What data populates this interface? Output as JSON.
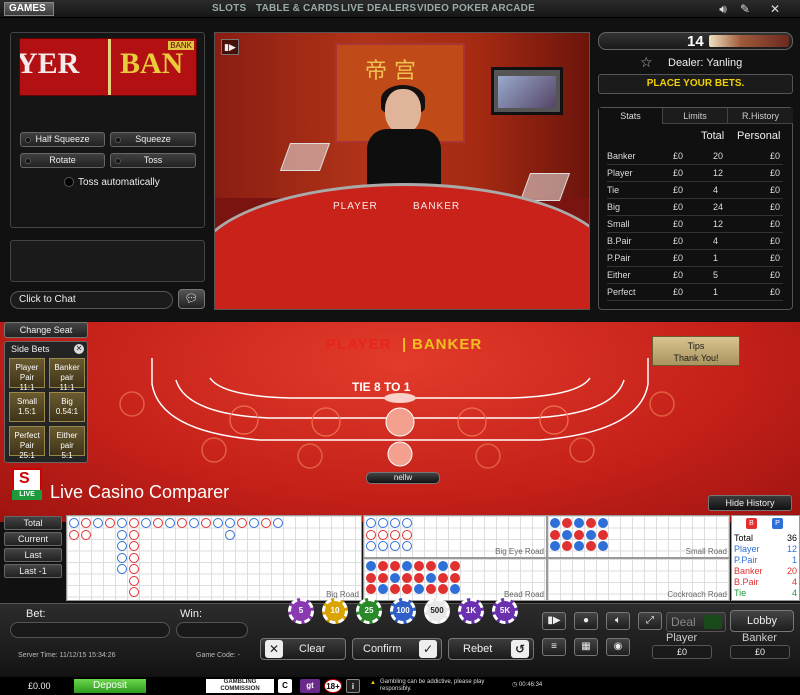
{
  "nav": {
    "games": "GAMES",
    "links": [
      "SLOTS",
      "TABLE & CARDS",
      "LIVE DEALERS",
      "VIDEO POKER",
      "ARCADE"
    ]
  },
  "left_panel": {
    "mini_cam": {
      "player_text": "YER",
      "banker_text": "BAN",
      "tag": "BANK"
    },
    "half_squeeze": "Half Squeeze",
    "squeeze": "Squeeze",
    "rotate": "Rotate",
    "toss": "Toss",
    "toss_auto": "Toss automatically",
    "chat_placeholder": "Click to Chat"
  },
  "video": {
    "chinese_chars": "帝 宫",
    "player_label": "PLAYER",
    "banker_label": "BANKER"
  },
  "right_panel": {
    "shoe_count": "14",
    "shoe_fraction": 0.4,
    "dealer": "Dealer: Yanling",
    "status": "PLACE YOUR BETS.",
    "tabs": [
      "Stats",
      "Limits",
      "R.History"
    ],
    "headers": {
      "total": "Total",
      "personal": "Personal"
    },
    "rows": [
      {
        "name": "Banker",
        "amount": "£0",
        "total": "20",
        "personal": "£0"
      },
      {
        "name": "Player",
        "amount": "£0",
        "total": "12",
        "personal": "£0"
      },
      {
        "name": "Tie",
        "amount": "£0",
        "total": "4",
        "personal": "£0"
      },
      {
        "name": "Big",
        "amount": "£0",
        "total": "24",
        "personal": "£0"
      },
      {
        "name": "Small",
        "amount": "£0",
        "total": "12",
        "personal": "£0"
      },
      {
        "name": "B.Pair",
        "amount": "£0",
        "total": "4",
        "personal": "£0"
      },
      {
        "name": "P.Pair",
        "amount": "£0",
        "total": "1",
        "personal": "£0"
      },
      {
        "name": "Either",
        "amount": "£0",
        "total": "5",
        "personal": "£0"
      },
      {
        "name": "Perfect",
        "amount": "£0",
        "total": "1",
        "personal": "£0"
      }
    ]
  },
  "table": {
    "change_seat": "Change Seat",
    "side_bets_title": "Side Bets",
    "side_bets": [
      {
        "name": "Player Pair",
        "odds": "11:1"
      },
      {
        "name": "Banker pair",
        "odds": "11:1"
      },
      {
        "name": "Small",
        "odds": "1.5:1"
      },
      {
        "name": "Big",
        "odds": "0.54:1"
      },
      {
        "name": "Perfect Pair",
        "odds": "25:1"
      },
      {
        "name": "Either pair",
        "odds": "5:1"
      }
    ],
    "player": "PLAYER",
    "sep": "|",
    "banker": "BANKER",
    "tips": "Tips",
    "thank_you": "Thank You!",
    "tie": "TIE 8 TO 1",
    "player_name": "nellw",
    "brand_live": "LIVE",
    "brand": "Live Casino Comparer",
    "hide_history": "Hide History"
  },
  "roads": {
    "buttons": [
      "Total",
      "Current",
      "Last",
      "Last -1"
    ],
    "big_road": "Big Road",
    "big_eye_road": "Big Eye Road",
    "small_road": "Small Road",
    "bead_road": "Bead Road",
    "cockroach_road": "Cockroach Road",
    "legend_b": "B",
    "legend_p": "P",
    "totals": [
      {
        "name": "Total",
        "value": "36",
        "color": "#000000"
      },
      {
        "name": "Player",
        "value": "12",
        "color": "#2f6fd8"
      },
      {
        "name": "P.Pair",
        "value": "1",
        "color": "#2f6fd8"
      },
      {
        "name": "Banker",
        "value": "20",
        "color": "#e03030"
      },
      {
        "name": "B.Pair",
        "value": "4",
        "color": "#e03030"
      },
      {
        "name": "Tie",
        "value": "4",
        "color": "#1c9a3c"
      }
    ]
  },
  "bottom": {
    "bet": "Bet:",
    "win": "Win:",
    "server_time": "Server Time: 11/12/15 15:34:26",
    "game_code": "Game Code: -",
    "chips": [
      {
        "value": "5",
        "color": "#8a3ab0"
      },
      {
        "value": "10",
        "color": "#d9a400"
      },
      {
        "value": "25",
        "color": "#2a8a2a"
      },
      {
        "value": "100",
        "color": "#2f5fc8"
      },
      {
        "value": "500",
        "color": "#e8e8e8"
      },
      {
        "value": "1K",
        "color": "#6a30b0"
      },
      {
        "value": "5K",
        "color": "#6a30b0"
      }
    ],
    "clear": "Clear",
    "confirm": "Confirm",
    "rebet": "Rebet",
    "deal": "Deal",
    "lobby": "Lobby",
    "player": "Player",
    "banker": "Banker",
    "player_value": "£0",
    "banker_value": "£0"
  },
  "footer": {
    "balance": "£0.00",
    "deposit": "Deposit",
    "gambling_line1": "GAMBLING",
    "gambling_line2": "COMMISSION",
    "age": "18+",
    "gt": "gt",
    "warning": "Gambling can be addictive, please play responsibly.",
    "clock": "00:46:34"
  },
  "colors": {
    "accent_yellow": "#f0d000",
    "felt_red": "#c42019",
    "player_red": "#e8241b",
    "banker_gold": "#f0c020",
    "deposit_green": "#3aa82a"
  }
}
